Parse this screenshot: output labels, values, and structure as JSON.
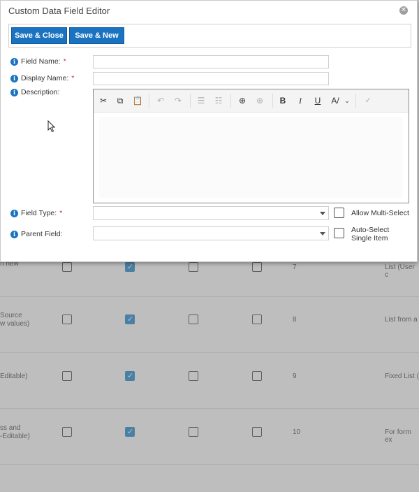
{
  "dialog": {
    "title": "Custom Data Field Editor",
    "close_icon": "close-icon",
    "buttons": {
      "save_close": "Save & Close",
      "save_new": "Save & New"
    },
    "fields": {
      "field_name": {
        "label": "Field Name:",
        "required": "*",
        "value": ""
      },
      "display_name": {
        "label": "Display Name:",
        "required": "*",
        "value": ""
      },
      "description": {
        "label": "Description:"
      },
      "field_type": {
        "label": "Field Type:",
        "required": "*",
        "value": ""
      },
      "parent_field": {
        "label": "Parent Field:",
        "value": ""
      }
    },
    "checkboxes": {
      "allow_multi_select": {
        "label": "Allow Multi-Select",
        "checked": false
      },
      "auto_select": {
        "label_line1": "Auto-Select",
        "label_line2": "Single Item",
        "checked": false
      }
    },
    "editor_toolbar": {
      "bold": "B",
      "italic": "I",
      "underline": "U"
    }
  },
  "background_table": {
    "rows": [
      {
        "left_text": "n new",
        "left_text2": "",
        "num": "7",
        "right_text": "List (User c"
      },
      {
        "left_text": "Source",
        "left_text2": "w values)",
        "num": "8",
        "right_text": "List from a"
      },
      {
        "left_text": "Editable)",
        "left_text2": "",
        "num": "9",
        "right_text": "Fixed List ("
      },
      {
        "left_text": "ss and",
        "left_text2": "-Editable)",
        "num": "10",
        "right_text": "For form ex"
      }
    ]
  },
  "colors": {
    "primary": "#1a73c1",
    "required": "#c0392b",
    "overlay": "#6e6e6e"
  }
}
